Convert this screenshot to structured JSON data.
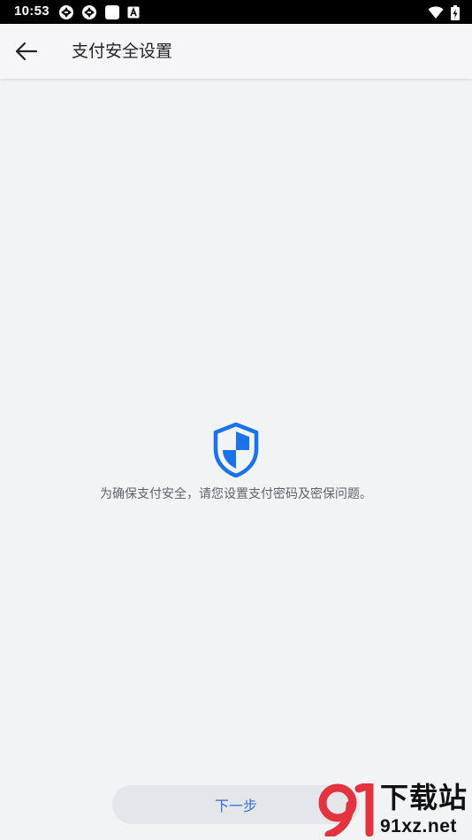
{
  "status_bar": {
    "time": "10:53",
    "left_icons": [
      "aperture-icon",
      "aperture-icon",
      "square-notification-icon",
      "a-box-icon"
    ],
    "right_icons": [
      "wifi-icon",
      "battery-charging-icon"
    ]
  },
  "app_bar": {
    "back_icon": "arrow-left-icon",
    "title": "支付安全设置"
  },
  "main": {
    "shield_icon": "security-shield-icon",
    "shield_color": "#1a73e8",
    "hint": "为确保支付安全，请您设置支付密码及密保问题。"
  },
  "footer": {
    "next_label": "下一步",
    "next_color": "#2f6fd8"
  },
  "watermark": {
    "title": "下载站",
    "url": "91xz.net",
    "mark_color": "#e2333f"
  }
}
